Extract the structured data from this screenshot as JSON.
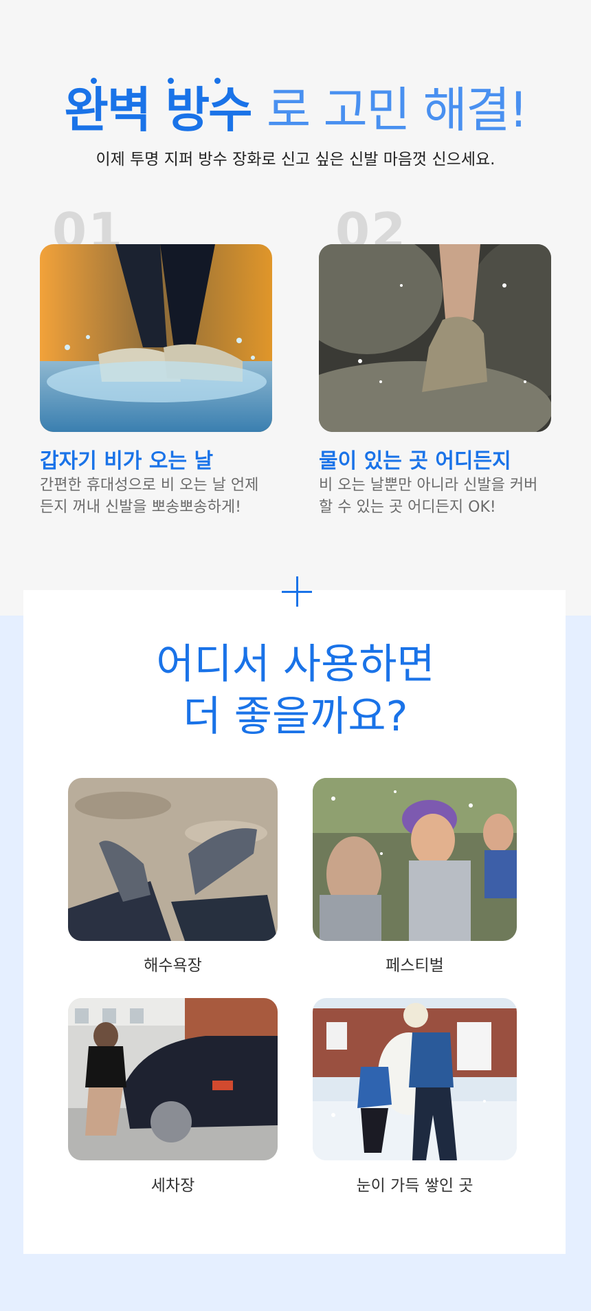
{
  "headline": {
    "bold": "완벽 방수",
    "light": "로 고민 해결!"
  },
  "subheadline": "이제 투명 지퍼 방수 장화로 신고 싶은 신발 마음껏 신으세요.",
  "features": [
    {
      "number": "01",
      "title": "갑자기 비가 오는 날",
      "desc_line1": "간편한 휴대성으로 비 오는 날 언제",
      "desc_line2": "든지 꺼내 신발을 뽀송뽀송하게!"
    },
    {
      "number": "02",
      "title": "물이 있는 곳 어디든지",
      "desc_line1": "비 오는 날뿐만 아니라 신발을 커버",
      "desc_line2": "할 수 있는 곳 어디든지 OK!"
    }
  ],
  "usage": {
    "title_line1": "어디서 사용하면",
    "title_line2": "더 좋을까요?",
    "places": [
      "해수욕장",
      "페스티벌",
      "세차장",
      "눈이 가득 쌓인 곳"
    ]
  },
  "colors": {
    "accent": "#1a73e8",
    "top_bg": "#f6f6f6",
    "bottom_bg": "#e5efff"
  }
}
